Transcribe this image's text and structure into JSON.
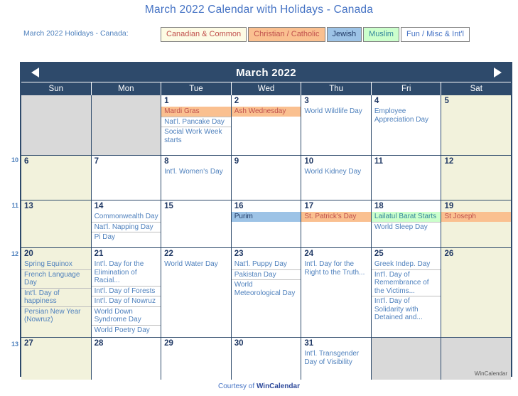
{
  "page": {
    "title": "March 2022 Calendar with Holidays - Canada",
    "legend_label": "March 2022 Holidays - Canada:",
    "footer_prefix": "Courtesy of ",
    "footer_brand": "WinCalendar",
    "watermark": "WinCalendar"
  },
  "legend": {
    "chips": [
      {
        "label": "Canadian & Common",
        "key": "canadian",
        "bg": "#FDFBE4",
        "fg": "#C0504D"
      },
      {
        "label": "Christian / Catholic",
        "key": "christian",
        "bg": "#FAC090",
        "fg": "#C0504D"
      },
      {
        "label": "Jewish",
        "key": "jewish",
        "bg": "#9DC3E6",
        "fg": "#1F3864"
      },
      {
        "label": "Muslim",
        "key": "muslim",
        "bg": "#CCFFCC",
        "fg": "#31859B"
      },
      {
        "label": "Fun / Misc & Int'l",
        "key": "fun",
        "bg": "#FFFFFF",
        "fg": "#4472C4"
      }
    ]
  },
  "calendar": {
    "month_title": "March 2022",
    "prev_label": "Previous month",
    "next_label": "Next month",
    "day_headers": [
      "Sun",
      "Mon",
      "Tue",
      "Wed",
      "Thu",
      "Fri",
      "Sat"
    ],
    "weeks": [
      {
        "week_number": "",
        "days": [
          {
            "num": "",
            "outside": true,
            "weekend": true,
            "events": []
          },
          {
            "num": "",
            "outside": true,
            "weekend": false,
            "events": []
          },
          {
            "num": "1",
            "outside": false,
            "weekend": false,
            "events": [
              {
                "text": "Mardi Gras",
                "cat": "christian"
              },
              {
                "text": "Nat'l. Pancake Day",
                "cat": ""
              },
              {
                "text": "Social Work Week starts",
                "cat": ""
              }
            ]
          },
          {
            "num": "2",
            "outside": false,
            "weekend": false,
            "events": [
              {
                "text": "Ash Wednesday",
                "cat": "christian"
              }
            ]
          },
          {
            "num": "3",
            "outside": false,
            "weekend": false,
            "events": [
              {
                "text": "World Wildlife Day",
                "cat": ""
              }
            ]
          },
          {
            "num": "4",
            "outside": false,
            "weekend": false,
            "events": [
              {
                "text": "Employee Appreciation Day",
                "cat": ""
              }
            ]
          },
          {
            "num": "5",
            "outside": false,
            "weekend": true,
            "events": []
          }
        ]
      },
      {
        "week_number": "10",
        "days": [
          {
            "num": "6",
            "outside": false,
            "weekend": true,
            "events": []
          },
          {
            "num": "7",
            "outside": false,
            "weekend": false,
            "events": []
          },
          {
            "num": "8",
            "outside": false,
            "weekend": false,
            "events": [
              {
                "text": "Int'l. Women's Day",
                "cat": ""
              }
            ]
          },
          {
            "num": "9",
            "outside": false,
            "weekend": false,
            "events": []
          },
          {
            "num": "10",
            "outside": false,
            "weekend": false,
            "events": [
              {
                "text": "World Kidney Day",
                "cat": ""
              }
            ]
          },
          {
            "num": "11",
            "outside": false,
            "weekend": false,
            "events": []
          },
          {
            "num": "12",
            "outside": false,
            "weekend": true,
            "events": []
          }
        ]
      },
      {
        "week_number": "11",
        "days": [
          {
            "num": "13",
            "outside": false,
            "weekend": true,
            "events": []
          },
          {
            "num": "14",
            "outside": false,
            "weekend": false,
            "events": [
              {
                "text": "Commonwealth Day",
                "cat": ""
              },
              {
                "text": "Nat'l. Napping Day",
                "cat": ""
              },
              {
                "text": "Pi Day",
                "cat": ""
              }
            ]
          },
          {
            "num": "15",
            "outside": false,
            "weekend": false,
            "events": []
          },
          {
            "num": "16",
            "outside": false,
            "weekend": false,
            "events": [
              {
                "text": "Purim",
                "cat": "jewish"
              }
            ]
          },
          {
            "num": "17",
            "outside": false,
            "weekend": false,
            "events": [
              {
                "text": "St. Patrick's Day",
                "cat": "christian"
              }
            ]
          },
          {
            "num": "18",
            "outside": false,
            "weekend": false,
            "events": [
              {
                "text": "Lailatul Barat Starts",
                "cat": "muslim"
              },
              {
                "text": "World Sleep Day",
                "cat": ""
              }
            ]
          },
          {
            "num": "19",
            "outside": false,
            "weekend": true,
            "events": [
              {
                "text": "St Joseph",
                "cat": "christian"
              }
            ]
          }
        ]
      },
      {
        "week_number": "12",
        "days": [
          {
            "num": "20",
            "outside": false,
            "weekend": true,
            "events": [
              {
                "text": "Spring Equinox",
                "cat": ""
              },
              {
                "text": "French Language Day",
                "cat": ""
              },
              {
                "text": "Int'l. Day of happiness",
                "cat": ""
              },
              {
                "text": "Persian New Year (Nowruz)",
                "cat": ""
              }
            ]
          },
          {
            "num": "21",
            "outside": false,
            "weekend": false,
            "events": [
              {
                "text": "Int'l. Day for the Elimination of Racial...",
                "cat": ""
              },
              {
                "text": "Int'l. Day of Forests",
                "cat": ""
              },
              {
                "text": "Int'l. Day of Nowruz",
                "cat": ""
              },
              {
                "text": "World Down Syndrome Day",
                "cat": ""
              },
              {
                "text": "World Poetry Day",
                "cat": ""
              }
            ]
          },
          {
            "num": "22",
            "outside": false,
            "weekend": false,
            "events": [
              {
                "text": "World Water Day",
                "cat": ""
              }
            ]
          },
          {
            "num": "23",
            "outside": false,
            "weekend": false,
            "events": [
              {
                "text": "Nat'l. Puppy Day",
                "cat": ""
              },
              {
                "text": "Pakistan Day",
                "cat": ""
              },
              {
                "text": "World Meteorological Day",
                "cat": ""
              }
            ]
          },
          {
            "num": "24",
            "outside": false,
            "weekend": false,
            "events": [
              {
                "text": "Int'l. Day for the Right to the Truth...",
                "cat": ""
              }
            ]
          },
          {
            "num": "25",
            "outside": false,
            "weekend": false,
            "events": [
              {
                "text": "Greek Indep. Day",
                "cat": ""
              },
              {
                "text": "Int'l. Day of Remembrance of the Victims...",
                "cat": ""
              },
              {
                "text": "Int'l. Day of Solidarity with Detained and...",
                "cat": ""
              }
            ]
          },
          {
            "num": "26",
            "outside": false,
            "weekend": true,
            "events": []
          }
        ]
      },
      {
        "week_number": "13",
        "days": [
          {
            "num": "27",
            "outside": false,
            "weekend": true,
            "events": []
          },
          {
            "num": "28",
            "outside": false,
            "weekend": false,
            "events": []
          },
          {
            "num": "29",
            "outside": false,
            "weekend": false,
            "events": []
          },
          {
            "num": "30",
            "outside": false,
            "weekend": false,
            "events": []
          },
          {
            "num": "31",
            "outside": false,
            "weekend": false,
            "events": [
              {
                "text": "Int'l. Transgender Day of Visibility",
                "cat": ""
              }
            ]
          },
          {
            "num": "",
            "outside": true,
            "weekend": false,
            "events": []
          },
          {
            "num": "",
            "outside": true,
            "weekend": true,
            "events": [],
            "watermark": true
          }
        ]
      }
    ]
  }
}
